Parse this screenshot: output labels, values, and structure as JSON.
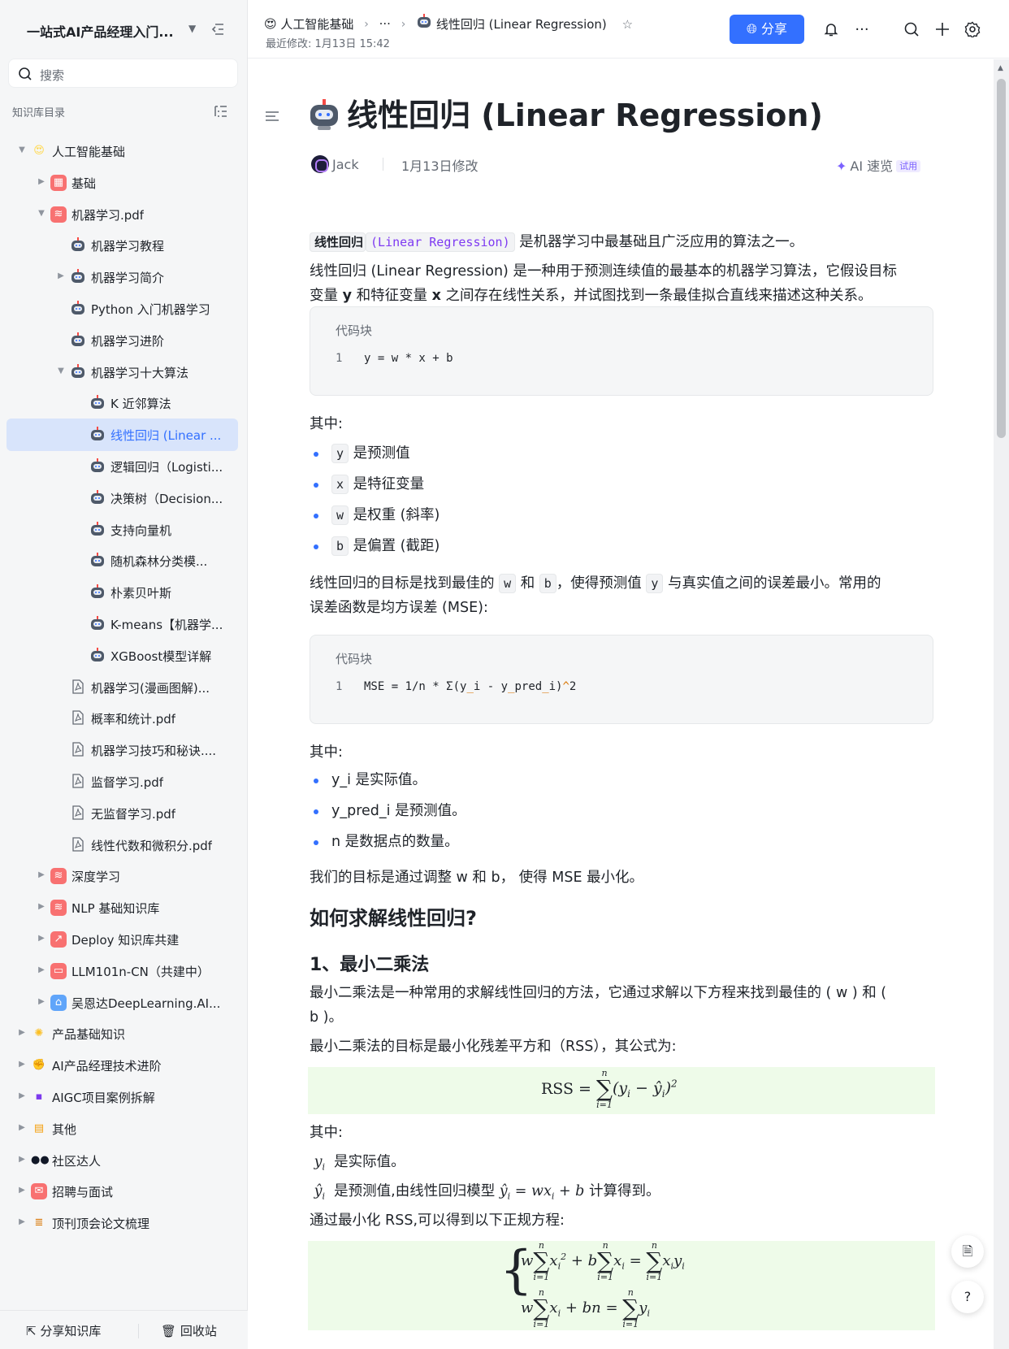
{
  "sidebar": {
    "title": "一站式AI产品经理入门...",
    "search_placeholder": "搜索",
    "section_label": "知识库目录",
    "items": [
      {
        "label": "人工智能基础",
        "level": 0,
        "expanded": true,
        "icon": "smiling-face-hearts-icon",
        "color": "#ffd84a"
      },
      {
        "label": "基础",
        "level": 1,
        "collapsed": true,
        "icon": "grid-icon",
        "color": "#f87171"
      },
      {
        "label": "机器学习.pdf",
        "level": 1,
        "expanded": true,
        "icon": "layers-icon",
        "color": "#f87171"
      },
      {
        "label": "机器学习教程",
        "level": 2,
        "icon": "robot-icon"
      },
      {
        "label": "机器学习简介",
        "level": 2,
        "collapsed": true,
        "icon": "robot-icon"
      },
      {
        "label": "Python 入门机器学习",
        "level": 2,
        "icon": "robot-icon"
      },
      {
        "label": "机器学习进阶",
        "level": 2,
        "icon": "robot-icon"
      },
      {
        "label": "机器学习十大算法",
        "level": 2,
        "expanded": true,
        "icon": "robot-icon"
      },
      {
        "label": "K 近邻算法",
        "level": 3,
        "icon": "robot-icon"
      },
      {
        "label": "线性回归 (Linear ...",
        "level": 3,
        "icon": "robot-icon",
        "active": true
      },
      {
        "label": "逻辑回归（Logisti...",
        "level": 3,
        "icon": "robot-icon"
      },
      {
        "label": "决策树（Decision...",
        "level": 3,
        "icon": "robot-icon"
      },
      {
        "label": "支持向量机",
        "level": 3,
        "icon": "robot-icon"
      },
      {
        "label": "随机森林分类模...",
        "level": 3,
        "icon": "robot-icon"
      },
      {
        "label": "朴素贝叶斯",
        "level": 3,
        "icon": "robot-icon"
      },
      {
        "label": "K-means【机器学...",
        "level": 3,
        "icon": "robot-icon"
      },
      {
        "label": "XGBoost模型详解",
        "level": 3,
        "icon": "robot-icon"
      },
      {
        "label": "机器学习(漫画图解)...",
        "level": 2,
        "icon": "pdf-file-icon"
      },
      {
        "label": "概率和统计.pdf",
        "level": 2,
        "icon": "pdf-file-icon"
      },
      {
        "label": "机器学习技巧和秘诀....",
        "level": 2,
        "icon": "pdf-file-icon"
      },
      {
        "label": "监督学习.pdf",
        "level": 2,
        "icon": "pdf-file-icon"
      },
      {
        "label": "无监督学习.pdf",
        "level": 2,
        "icon": "pdf-file-icon"
      },
      {
        "label": "线性代数和微积分.pdf",
        "level": 2,
        "icon": "pdf-file-icon"
      },
      {
        "label": "深度学习",
        "level": 1,
        "collapsed": true,
        "icon": "layers-icon",
        "color": "#f87171"
      },
      {
        "label": "NLP 基础知识库",
        "level": 1,
        "collapsed": true,
        "icon": "layers-icon",
        "color": "#f87171"
      },
      {
        "label": "Deploy 知识库共建",
        "level": 1,
        "collapsed": true,
        "icon": "chart-up-icon",
        "color": "#f87171"
      },
      {
        "label": "LLM101n-CN（共建中）",
        "level": 1,
        "collapsed": true,
        "icon": "screen-icon",
        "color": "#f87171"
      },
      {
        "label": "吴恩达DeepLearning.AI...",
        "level": 1,
        "collapsed": true,
        "icon": "house-icon",
        "color": "#60a5fa"
      },
      {
        "label": "产品基础知识",
        "level": 0,
        "collapsed": true,
        "icon": "dizzy-icon",
        "color": "#fbbf24"
      },
      {
        "label": "AI产品经理技术进阶",
        "level": 0,
        "collapsed": true,
        "icon": "flexed-biceps-icon",
        "color": "#fbbf24"
      },
      {
        "label": "AIGC项目案例拆解",
        "level": 0,
        "collapsed": true,
        "icon": "floppy-disk-icon",
        "color": "#7c3aed"
      },
      {
        "label": "其他",
        "level": 0,
        "collapsed": true,
        "icon": "clipboard-icon",
        "color": "#f59e0b"
      },
      {
        "label": "社区达人",
        "level": 0,
        "collapsed": true,
        "icon": "eyes-icon",
        "color": "#111827"
      },
      {
        "label": "招聘与面试",
        "level": 0,
        "collapsed": true,
        "icon": "envelope-icon",
        "color": "#f87171"
      },
      {
        "label": "顶刊顶会论文梳理",
        "level": 0,
        "collapsed": true,
        "icon": "scroll-icon",
        "color": "#d97706"
      }
    ],
    "footer": {
      "share_label": "分享知识库",
      "trash_label": "回收站"
    }
  },
  "header": {
    "crumbs": [
      "人工智能基础",
      "···",
      "线性回归 (Linear Regression)"
    ],
    "last_modified": "最近修改: 1月13日 15:42",
    "share_label": "分享"
  },
  "doc": {
    "title": "线性回归 (Linear Regression)",
    "author": "Jack",
    "edited": "1月13日修改",
    "ai_read": "AI 速览",
    "ai_badge": "试用",
    "intro_bold": "线性回归",
    "intro_code": "(Linear Regression)",
    "intro_rest": "是机器学习中最基础且广泛应用的算法之一。",
    "para1_a": "线性回归 (Linear Regression) 是一种用于预测连续值的最基本的机器学习算法，它假设目标",
    "para1_b_pre": "变量 ",
    "para1_b_y": "y",
    "para1_b_mid": " 和特征变量 ",
    "para1_b_x": "x",
    "para1_b_post": " 之间存在线性关系，并试图找到一条最佳拟合直线来描述这种关系。",
    "code1_caption": "代码块",
    "code1_line": "1",
    "code1_text": "y = w * x + b",
    "where1": "其中:",
    "bullets1": [
      {
        "code": "y",
        "text": "是预测值"
      },
      {
        "code": "x",
        "text": "是特征变量"
      },
      {
        "code": "w",
        "text": "是权重 (斜率)"
      },
      {
        "code": "b",
        "text": "是偏置 (截距)"
      }
    ],
    "para2_a1": "线性回归的目标是找到最佳的",
    "para2_w": "w",
    "para2_and": "和",
    "para2_b": "b",
    "para2_a2": "，使得预测值",
    "para2_y": "y",
    "para2_a3": "与真实值之间的误差最小。常用的",
    "para2_line2": "误差函数是均方误差 (MSE):",
    "code2_caption": "代码块",
    "code2_line": "1",
    "code2_text_a": "MSE = 1/n * Σ(y",
    "code2_hl1": "_",
    "code2_text_b": "i - y",
    "code2_hl2": "_",
    "code2_text_c": "pred",
    "code2_hl3": "_",
    "code2_text_d": "i)",
    "code2_hl4": "^",
    "code2_text_e": "2",
    "where2": "其中:",
    "bullets2": [
      "y_i 是实际值。",
      "y_pred_i 是预测值。",
      "n 是数据点的数量。"
    ],
    "para3": "我们的目标是通过调整 w 和 b， 使得 MSE 最小化。",
    "h2": "如何求解线性回归?",
    "h3": "1、最小二乘法",
    "para4_a": "最小二乘法是一种常用的求解线性回归的方法，它通过求解以下方程来找到最佳的 ( w ) 和 (",
    "para4_b": "b )。",
    "para5": "最小二乘法的目标是最小化残差平方和（RSS），其公式为:",
    "where3": "其中:",
    "def1": "是实际值。",
    "def2_a": "是预测值,由线性回归模型",
    "def2_b": "计算得到。",
    "para6": "通过最小化 RSS,可以得到以下正规方程:"
  }
}
